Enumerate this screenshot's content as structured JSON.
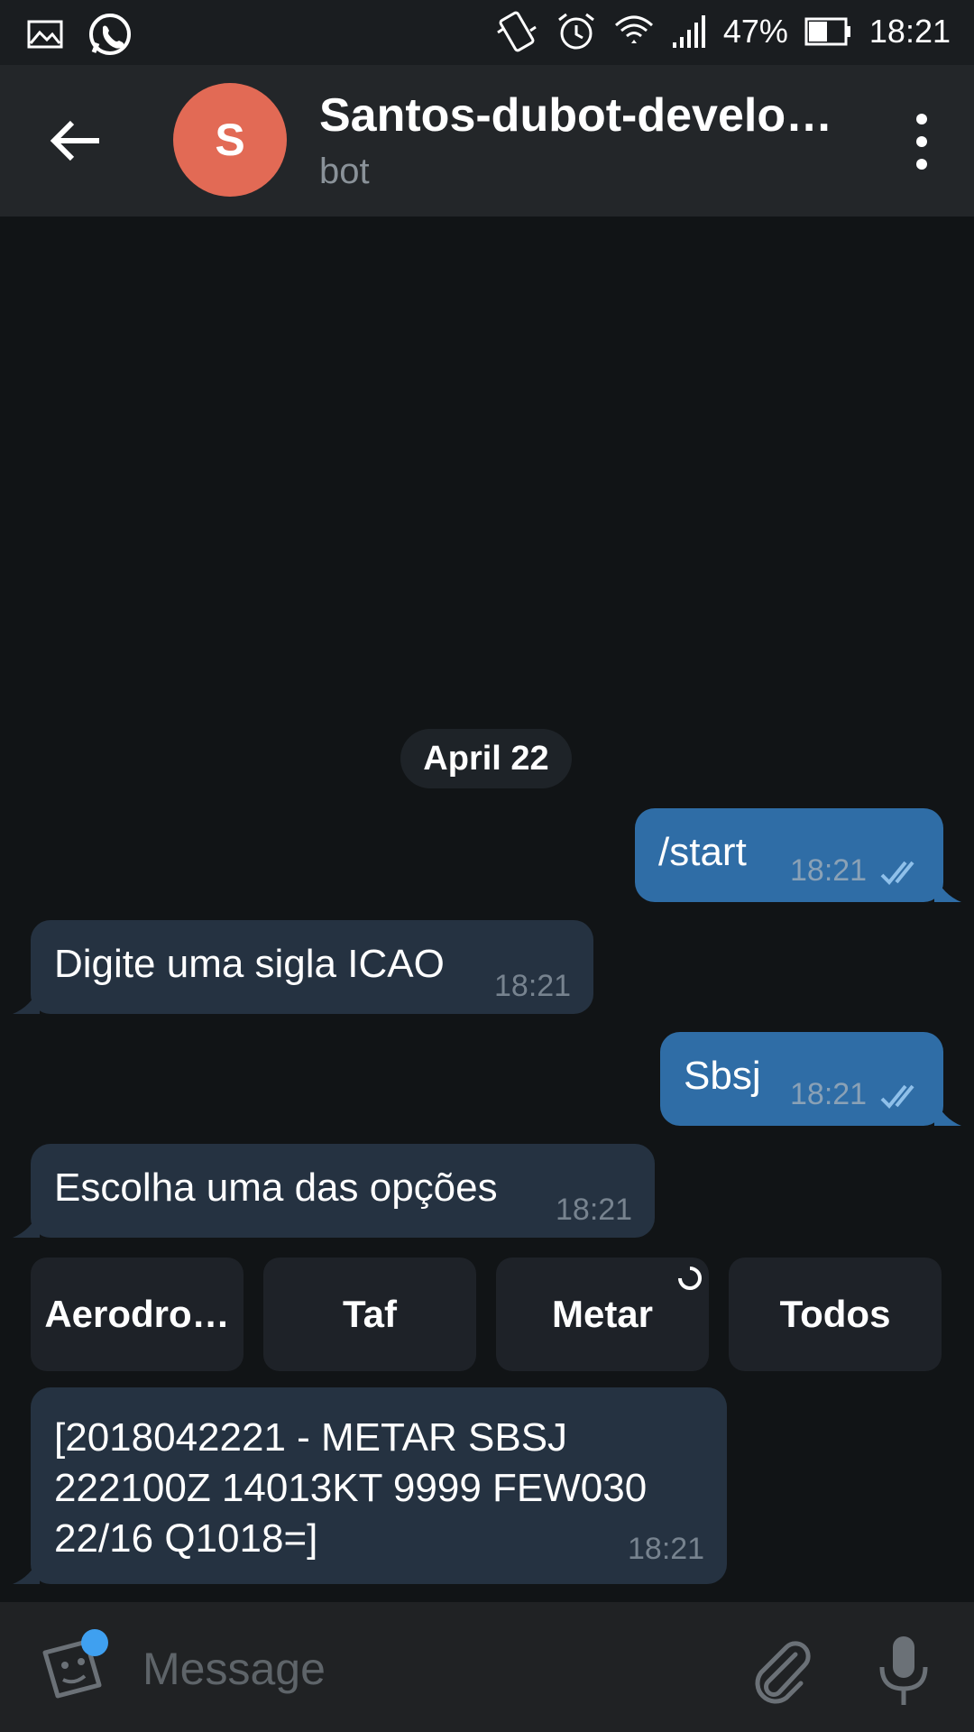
{
  "status_bar": {
    "battery_percent": "47%",
    "time": "18:21",
    "icons": [
      "image-icon",
      "whatsapp-icon",
      "vibrate-icon",
      "alarm-icon",
      "wifi-icon",
      "signal-icon",
      "battery-icon"
    ]
  },
  "header": {
    "avatar_letter": "S",
    "avatar_color": "#e26a55",
    "title": "Santos-dubot-develop…",
    "subtitle": "bot"
  },
  "chat": {
    "date_label": "April 22",
    "messages": [
      {
        "direction": "out",
        "text": "/start",
        "time": "18:21"
      },
      {
        "direction": "in",
        "text": "Digite uma sigla ICAO",
        "time": "18:21"
      },
      {
        "direction": "out",
        "text": "Sbsj",
        "time": "18:21"
      },
      {
        "direction": "in",
        "text": "Escolha uma das opções",
        "time": "18:21"
      }
    ],
    "keyboard": [
      "Aerodro…",
      "Taf",
      "Metar",
      "Todos"
    ],
    "metar": {
      "lines": [
        "[2018042221 - METAR SBSJ",
        "222100Z 14013KT 9999 FEW030",
        "22/16 Q1018=]"
      ],
      "time": "18:21"
    }
  },
  "input": {
    "placeholder": "Message"
  },
  "colors": {
    "outgoing_bubble": "#2f6da6",
    "incoming_bubble": "#253241",
    "accent": "#3fa0f0"
  }
}
